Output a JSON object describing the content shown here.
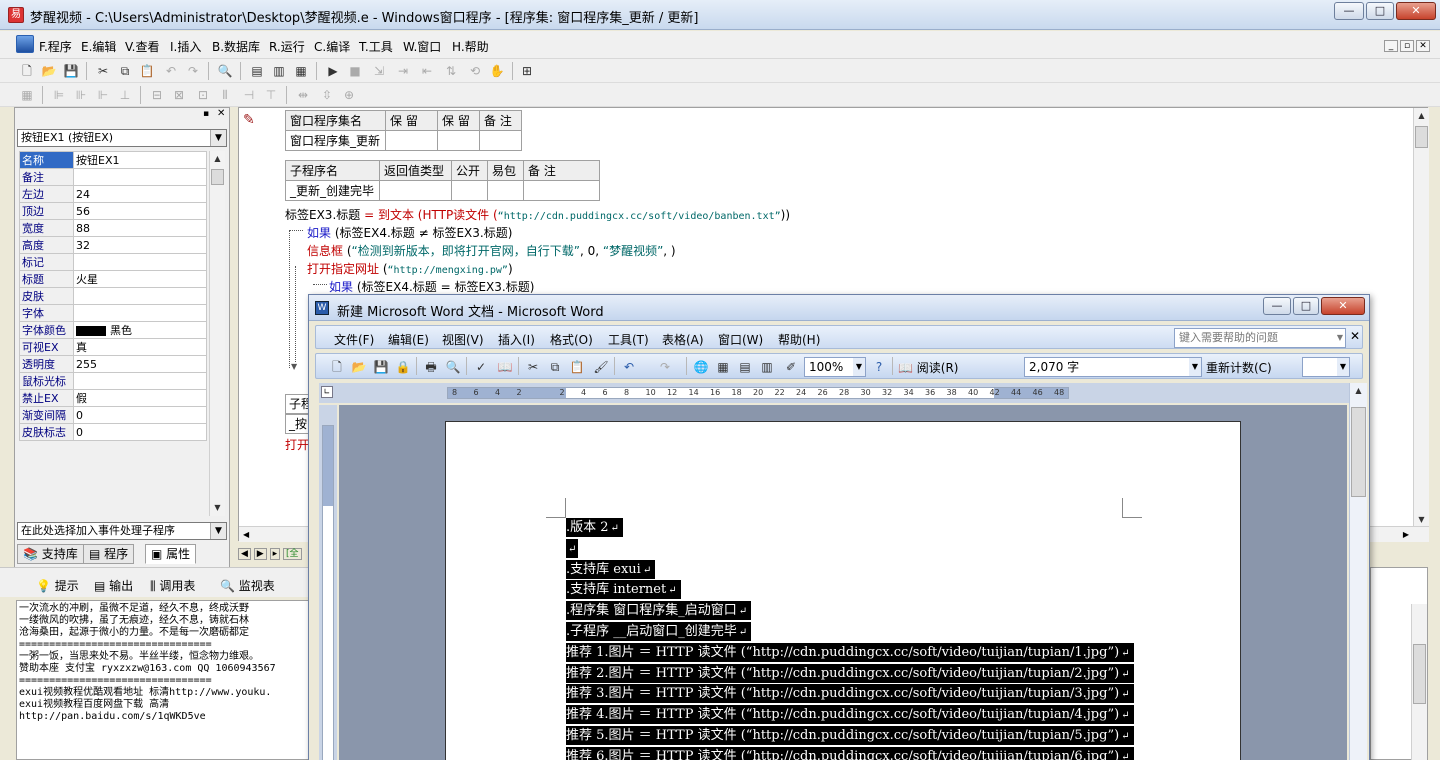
{
  "window": {
    "title": "梦醒视频 - C:\\Users\\Administrator\\Desktop\\梦醒视频.e - Windows窗口程序 - [程序集: 窗口程序集_更新 / 更新]"
  },
  "menu": {
    "items": [
      "F.程序",
      "E.编辑",
      "V.查看",
      "I.插入",
      "B.数据库",
      "R.运行",
      "C.编译",
      "T.工具",
      "W.窗口",
      "H.帮助"
    ]
  },
  "props": {
    "selector": "按钮EX1 (按钮EX)",
    "rows": [
      {
        "k": "名称",
        "v": "按钮EX1"
      },
      {
        "k": "备注",
        "v": ""
      },
      {
        "k": "左边",
        "v": "24"
      },
      {
        "k": "顶边",
        "v": "56"
      },
      {
        "k": "宽度",
        "v": "88"
      },
      {
        "k": "高度",
        "v": "32"
      },
      {
        "k": "标记",
        "v": ""
      },
      {
        "k": "标题",
        "v": "火星"
      },
      {
        "k": "皮肤",
        "v": ""
      },
      {
        "k": "字体",
        "v": ""
      },
      {
        "k": "字体颜色",
        "v": "黑色"
      },
      {
        "k": "可视EX",
        "v": "真"
      },
      {
        "k": "透明度",
        "v": "255"
      },
      {
        "k": "鼠标光标",
        "v": ""
      },
      {
        "k": "禁止EX",
        "v": "假"
      },
      {
        "k": "渐变间隔",
        "v": "0"
      },
      {
        "k": "皮肤标志",
        "v": "0"
      }
    ],
    "event_selector": "在此处选择加入事件处理子程序",
    "tabs": [
      "支持库",
      "程序",
      "属性"
    ]
  },
  "editor": {
    "table1": {
      "headers": [
        "窗口程序集名",
        "保 留",
        "保 留",
        "备 注"
      ],
      "row": [
        "窗口程序集_更新",
        "",
        "",
        ""
      ]
    },
    "table2": {
      "headers": [
        "子程序名",
        "返回值类型",
        "公开",
        "易包",
        "备 注"
      ],
      "row": [
        "_更新_创建完毕",
        "",
        "",
        "",
        ""
      ]
    },
    "line1_a": "标签EX3.标题",
    "line1_b": " = ",
    "line1_c": "到文本",
    "line1_d": " (HTTP读文件 (",
    "line1_e": "“http://cdn.puddingcx.cc/soft/video/banben.txt”",
    "line1_f": "))",
    "line2_a": "如果",
    "line2_b": " (标签EX4.标题 ≠ 标签EX3.标题)",
    "line3_a": "信息框",
    "line3_b": " (",
    "line3_c": "“检测到新版本，即将打开官网，自行下载”",
    "line3_d": ", 0, ",
    "line3_e": "“梦醒视频”",
    "line3_f": ", )",
    "line4_a": "打开指定网址",
    "line4_b": " (",
    "line4_c": "“http://mengxing.pw”",
    "line4_d": ")",
    "line5_a": "如果",
    "line5_b": " (标签EX4.标题 = 标签EX3.标题)",
    "frag1": "子程",
    "frag2": "_按",
    "frag3": "打开"
  },
  "bottom": {
    "tabs": [
      "提示",
      "输出",
      "调用表",
      "监视表"
    ],
    "lines": [
      "一次流水的冲刷，虽微不足道，经久不息，终成沃野",
      "一缕微风的吹拂，虽了无痕迹，经久不息，铸就石林",
      "沧海桑田，起源于微小的力量。不是每一次磨砺都定",
      "================================",
      "一粥一饭，当思来处不易。半丝半缕，恒念物力维艰。",
      "赞助本座 支付宝 ryxzxzw@163.com QQ 1060943567",
      "================================",
      "exui视频教程优酷观看地址 标清http://www.youku.",
      "exui视频教程百度网盘下载 高清",
      "http://pan.baidu.com/s/1qWKD5ve"
    ]
  },
  "word": {
    "title": "新建 Microsoft Word 文档 - Microsoft Word",
    "menu": [
      "文件(F)",
      "编辑(E)",
      "视图(V)",
      "插入(I)",
      "格式(O)",
      "工具(T)",
      "表格(A)",
      "窗口(W)",
      "帮助(H)"
    ],
    "help_placeholder": "键入需要帮助的问题",
    "zoom": "100%",
    "read_label": "阅读(R)",
    "word_count": "2,070 字",
    "recount_label": "重新计数(C)",
    "ruler": [
      "8",
      "6",
      "4",
      "2",
      "",
      "2",
      "4",
      "6",
      "8",
      "10",
      "12",
      "14",
      "16",
      "18",
      "20",
      "22",
      "24",
      "26",
      "28",
      "30",
      "32",
      "34",
      "36",
      "38",
      "40",
      "42",
      "44",
      "46",
      "48"
    ],
    "doc_lines": [
      ".版本 2",
      "",
      ".支持库 exui",
      ".支持库 internet",
      ".程序集 窗口程序集_启动窗口",
      ".子程序 __启动窗口_创建完毕",
      "推荐 1.图片 ＝ HTTP 读文件 (“http://cdn.puddingcx.cc/soft/video/tuijian/tupian/1.jpg”)",
      "推荐 2.图片 ＝ HTTP 读文件 (“http://cdn.puddingcx.cc/soft/video/tuijian/tupian/2.jpg”)",
      "推荐 3.图片 ＝ HTTP 读文件 (“http://cdn.puddingcx.cc/soft/video/tuijian/tupian/3.jpg”)",
      "推荐 4.图片 ＝ HTTP 读文件 (“http://cdn.puddingcx.cc/soft/video/tuijian/tupian/4.jpg”)",
      "推荐 5.图片 ＝ HTTP 读文件 (“http://cdn.puddingcx.cc/soft/video/tuijian/tupian/5.jpg”)",
      "推荐 6.图片 ＝ HTTP 读文件 (“http://cdn.puddingcx.cc/soft/video/tuijian/tupian/6.jpg”)"
    ]
  },
  "colors": {
    "selection": "#316ac5",
    "code_red": "#c00000",
    "code_blue": "#1a1ac8",
    "string": "#006868"
  }
}
